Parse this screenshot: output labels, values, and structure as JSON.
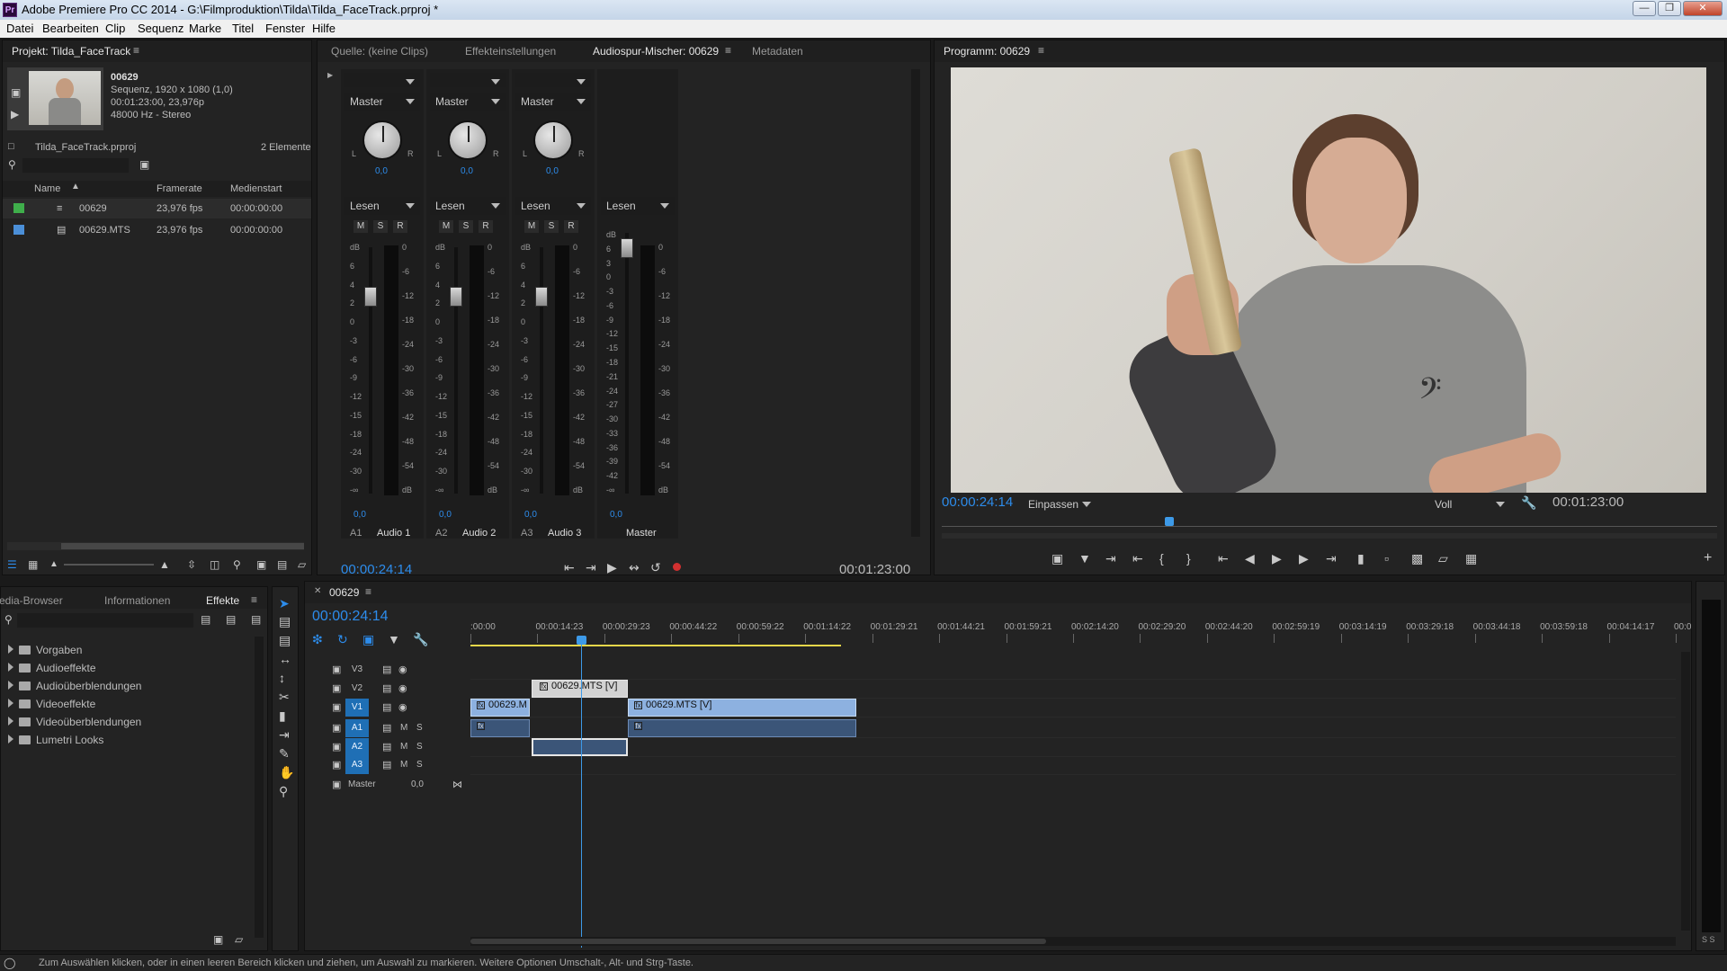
{
  "window": {
    "title": "Adobe Premiere Pro CC 2014 - G:\\Filmproduktion\\Tilda\\Tilda_FaceTrack.prproj *",
    "app_icon": "Pr"
  },
  "menu": [
    "Datei",
    "Bearbeiten",
    "Clip",
    "Sequenz",
    "Marke",
    "Titel",
    "Fenster",
    "Hilfe"
  ],
  "project": {
    "tab": "Projekt: Tilda_FaceTrack",
    "preview": {
      "name": "00629",
      "line1": "Sequenz, 1920 x 1080 (1,0)",
      "line2": "00:01:23:00, 23,976p",
      "line3": "48000 Hz - Stereo"
    },
    "file": "Tilda_FaceTrack.prproj",
    "count": "2 Elemente",
    "columns": [
      "Name",
      "Framerate",
      "Medienstart"
    ],
    "rows": [
      {
        "name": "00629",
        "fps": "23,976 fps",
        "start": "00:00:00:00",
        "color": "#3fae4b"
      },
      {
        "name": "00629.MTS",
        "fps": "23,976 fps",
        "start": "00:00:00:00",
        "color": "#4b8fd8"
      }
    ]
  },
  "source_tabs": [
    "Quelle: (keine Clips)",
    "Effekteinstellungen",
    "Audiospur-Mischer: 00629",
    "Metadaten"
  ],
  "mixer": {
    "channels": [
      {
        "route": "Master",
        "pan": "0,0",
        "mode": "Lesen",
        "vol": "0,0",
        "track": "A1",
        "name": "Audio 1"
      },
      {
        "route": "Master",
        "pan": "0,0",
        "mode": "Lesen",
        "vol": "0,0",
        "track": "A2",
        "name": "Audio 2"
      },
      {
        "route": "Master",
        "pan": "0,0",
        "mode": "Lesen",
        "vol": "0,0",
        "track": "A3",
        "name": "Audio 3"
      }
    ],
    "master": {
      "mode": "Lesen",
      "vol": "0,0",
      "name": "Master"
    },
    "buttons": [
      "M",
      "S",
      "R"
    ],
    "left_scale": [
      "dB",
      "6",
      "4",
      "2",
      "0",
      "-3",
      "-6",
      "-9",
      "-12",
      "-15",
      "-18",
      "-24",
      "-30",
      "-∞"
    ],
    "right_scale": [
      "0",
      "-6",
      "-12",
      "-18",
      "-24",
      "-30",
      "-36",
      "-42",
      "-48",
      "-54",
      "dB"
    ],
    "master_left_scale": [
      "dB",
      "6",
      "3",
      "0",
      "-3",
      "-6",
      "-9",
      "-12",
      "-15",
      "-18",
      "-21",
      "-24",
      "-27",
      "-30",
      "-33",
      "-36",
      "-39",
      "-42",
      "-∞"
    ],
    "pan_L": "L",
    "pan_R": "R",
    "time_left": "00:00:24:14",
    "time_right": "00:01:23:00"
  },
  "program": {
    "tab": "Programm: 00629",
    "time_left": "00:00:24:14",
    "fit": "Einpassen",
    "quality": "Voll",
    "time_right": "00:01:23:00",
    "playhead_fraction": 0.294
  },
  "effects_panel": {
    "tabs": [
      "Media-Browser",
      "Informationen",
      "Effekte"
    ],
    "items": [
      "Vorgaben",
      "Audioeffekte",
      "Audioüberblendungen",
      "Videoeffekte",
      "Videoüberblendungen",
      "Lumetri Looks"
    ]
  },
  "timeline": {
    "tab": "00629",
    "timecode": "00:00:24:14",
    "ruler": [
      ":00:00",
      "00:00:14:23",
      "00:00:29:23",
      "00:00:44:22",
      "00:00:59:22",
      "00:01:14:22",
      "00:01:29:21",
      "00:01:44:21",
      "00:01:59:21",
      "00:02:14:20",
      "00:02:29:20",
      "00:02:44:20",
      "00:02:59:19",
      "00:03:14:19",
      "00:03:29:18",
      "00:03:44:18",
      "00:03:59:18",
      "00:04:14:17",
      "00:0"
    ],
    "tracks": [
      {
        "id": "V3",
        "type": "video"
      },
      {
        "id": "V2",
        "type": "video"
      },
      {
        "id": "V1",
        "type": "video",
        "active": true
      },
      {
        "id": "A1",
        "type": "audio",
        "active": true
      },
      {
        "id": "A2",
        "type": "audio",
        "active": true
      },
      {
        "id": "A3",
        "type": "audio",
        "active": true
      }
    ],
    "master_label": "Master",
    "master_value": "0,0",
    "clips": {
      "v1a": "00629.M",
      "v1b": "00629.MTS [V]",
      "v2": "00629.MTS [V]"
    },
    "m_label": "M",
    "s_label": "S"
  },
  "status": {
    "text": "Zum Auswählen klicken, oder in einen leeren Bereich klicken und ziehen, um Auswahl zu markieren. Weitere Optionen Umschalt-, Alt- und Strg-Taste."
  },
  "vu": {
    "labels": "S S"
  }
}
